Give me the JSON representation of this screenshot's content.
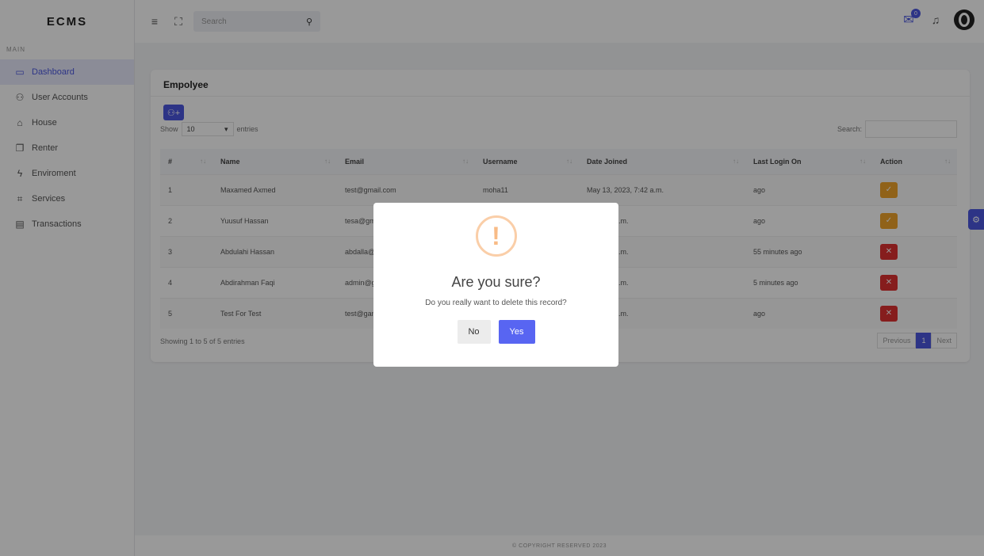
{
  "app": {
    "brand": "ECMS",
    "section": "MAIN"
  },
  "sidebar": {
    "items": [
      {
        "label": "Dashboard",
        "icon": "monitor-icon"
      },
      {
        "label": "User Accounts",
        "icon": "user-icon"
      },
      {
        "label": "House",
        "icon": "house-icon"
      },
      {
        "label": "Renter",
        "icon": "copy-icon"
      },
      {
        "label": "Enviroment",
        "icon": "bolt-icon"
      },
      {
        "label": "Services",
        "icon": "building-icon"
      },
      {
        "label": "Transactions",
        "icon": "card-icon"
      }
    ]
  },
  "header": {
    "search_placeholder": "Search",
    "mail_badge": "0"
  },
  "card": {
    "title": "Empolyee",
    "show_label": "Show",
    "entries_value": "10",
    "entries_label": "entries",
    "search_label": "Search:",
    "columns": [
      "#",
      "Name",
      "Email",
      "Username",
      "Date Joined",
      "Last Login On",
      "Action"
    ],
    "rows": [
      {
        "num": "1",
        "name": "Maxamed Axmed",
        "email": "test@gmail.com",
        "username": "moha11",
        "date": "May 13, 2023, 7:42 a.m.",
        "login": "ago",
        "action": "check"
      },
      {
        "num": "2",
        "name": "Yuusuf Hassan",
        "email": "tesa@gm",
        "username": "",
        "date": "23, 7:46 a.m.",
        "login": "ago",
        "action": "check"
      },
      {
        "num": "3",
        "name": "Abdulahi Hassan",
        "email": "abdalla@",
        "username": "",
        "date": "23, 7:54 a.m.",
        "login": "55 minutes ago",
        "action": "x"
      },
      {
        "num": "4",
        "name": "Abdirahman Faqi",
        "email": "admin@g",
        "username": "",
        "date": "23, 5:56 a.m.",
        "login": "5 minutes ago",
        "action": "x"
      },
      {
        "num": "5",
        "name": "Test For Test",
        "email": "test@gan",
        "username": "",
        "date": "23, 9:27 a.m.",
        "login": "ago",
        "action": "x"
      }
    ],
    "info": "Showing 1 to 5 of 5 entries",
    "pager": {
      "prev": "Previous",
      "current": "1",
      "next": "Next"
    }
  },
  "footer": "© COPYRIGHT RESERVED 2023",
  "modal": {
    "title": "Are you sure?",
    "text": "Do you really want to delete this record?",
    "no": "No",
    "yes": "Yes"
  }
}
